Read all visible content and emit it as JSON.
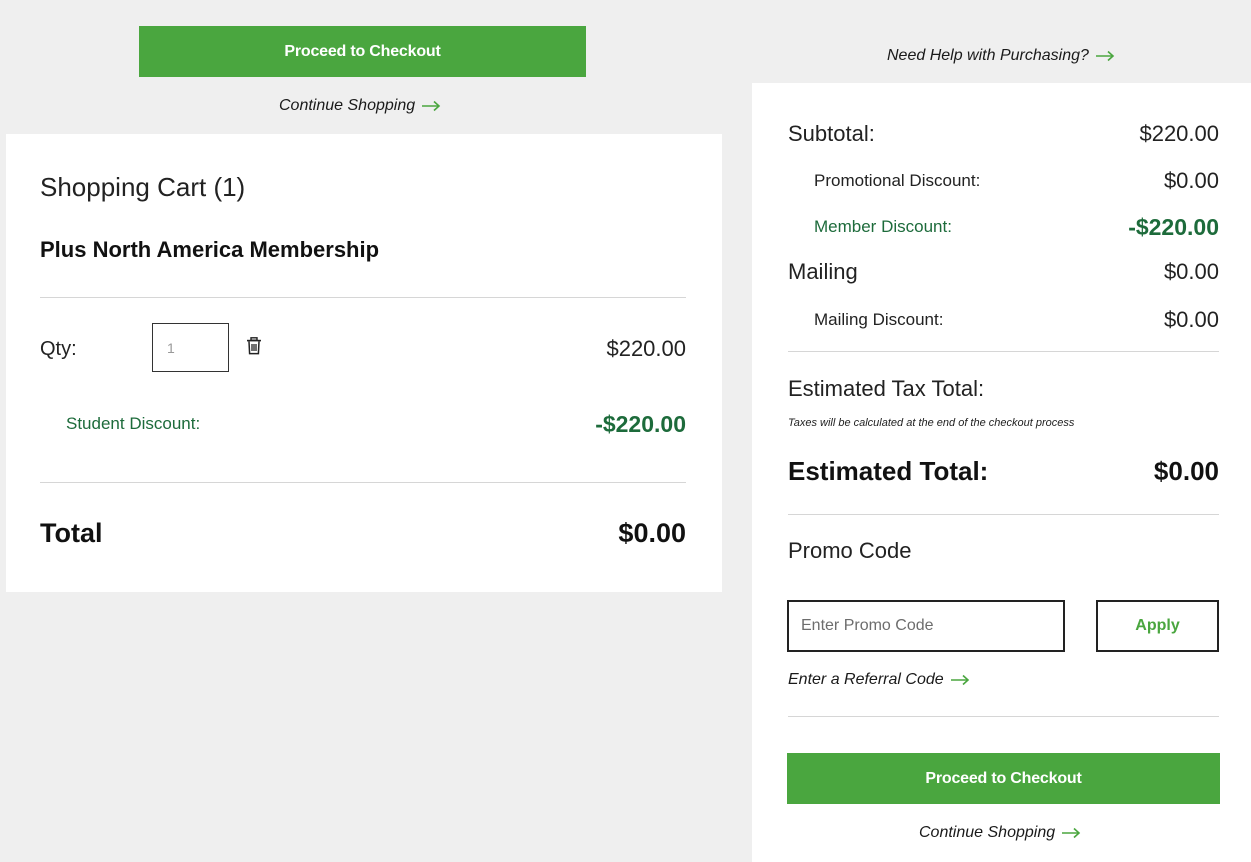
{
  "top": {
    "checkout_label": "Proceed to Checkout",
    "continue_label": "Continue Shopping",
    "help_label": "Need Help with Purchasing?"
  },
  "cart": {
    "title": "Shopping Cart (1)",
    "product_name": "Plus North America Membership",
    "qty_label": "Qty:",
    "qty_value": "1",
    "item_price": "$220.00",
    "discount_label": "Student Discount:",
    "discount_value": "-$220.00",
    "total_label": "Total",
    "total_value": "$0.00"
  },
  "summary": {
    "subtotal_label": "Subtotal:",
    "subtotal_value": "$220.00",
    "promo_discount_label": "Promotional Discount:",
    "promo_discount_value": "$0.00",
    "member_discount_label": "Member Discount:",
    "member_discount_value": "-$220.00",
    "mailing_label": "Mailing",
    "mailing_value": "$0.00",
    "mailing_discount_label": "Mailing Discount:",
    "mailing_discount_value": "$0.00",
    "tax_label": "Estimated Tax Total:",
    "tax_note": "Taxes will be calculated at the end of the checkout process",
    "estimated_total_label": "Estimated Total:",
    "estimated_total_value": "$0.00",
    "promo_heading": "Promo Code",
    "promo_placeholder": "Enter Promo Code",
    "apply_label": "Apply",
    "referral_label": "Enter a Referral Code",
    "checkout_label": "Proceed to Checkout",
    "continue_label": "Continue Shopping"
  },
  "colors": {
    "brand_green": "#4aa63f",
    "discount_green": "#1d6b3b",
    "page_bg": "#efefef"
  },
  "icons": {
    "arrow": "right-arrow-icon",
    "trash": "trash-icon"
  }
}
